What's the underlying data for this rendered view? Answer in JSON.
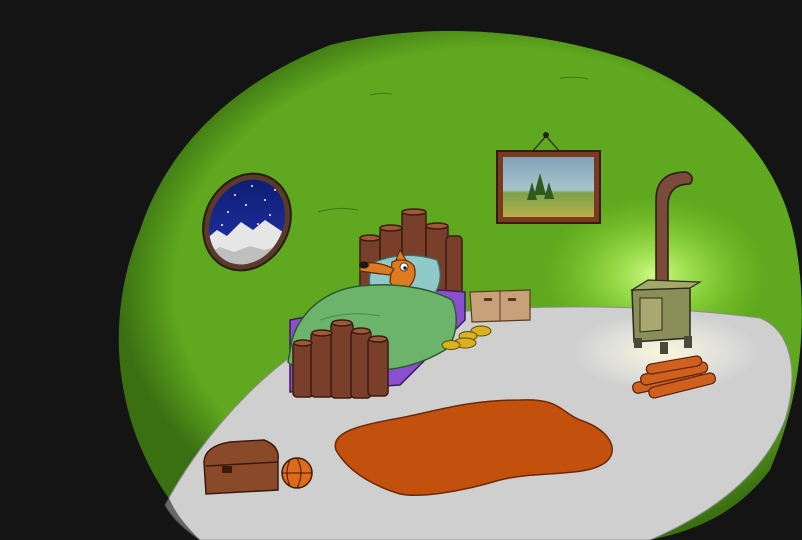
{
  "game": {
    "scene": "burrow-bedroom",
    "hud_text": ""
  },
  "colors": {
    "background": "#141414",
    "cave_wall": "#5fa81f",
    "floor": "#cfcfcf",
    "rug": "#c4500e",
    "stove_glow": "#b8f06a",
    "window_sky": "#1a2a8a",
    "logs": "#7a3f2a",
    "blanket": "#6cb36c",
    "bed_frame": "#8a4fd0",
    "fox": "#e07a1e"
  },
  "objects": [
    {
      "name": "round-window",
      "icon": "night-window-icon",
      "clickable": true
    },
    {
      "name": "framed-picture",
      "icon": "landscape-painting-icon",
      "clickable": true
    },
    {
      "name": "log-bed",
      "icon": "bed-icon",
      "clickable": true
    },
    {
      "name": "fox-character",
      "icon": "fox-icon",
      "clickable": true
    },
    {
      "name": "slippers",
      "icon": "slippers-icon",
      "clickable": true
    },
    {
      "name": "drawer-box",
      "icon": "drawer-icon",
      "clickable": true
    },
    {
      "name": "wood-stove",
      "icon": "stove-icon",
      "clickable": true
    },
    {
      "name": "firewood-pile",
      "icon": "firewood-icon",
      "clickable": true
    },
    {
      "name": "orange-rug",
      "icon": "rug-icon",
      "clickable": true
    },
    {
      "name": "treasure-chest",
      "icon": "chest-icon",
      "clickable": true
    },
    {
      "name": "basketball",
      "icon": "ball-icon",
      "clickable": true
    }
  ]
}
